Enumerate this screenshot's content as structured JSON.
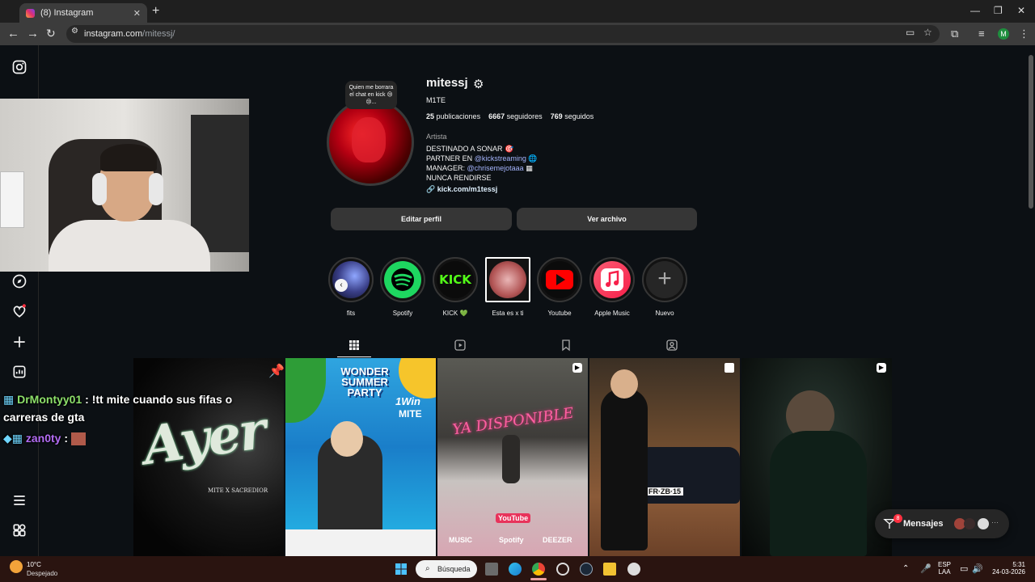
{
  "browser": {
    "tab_title": "(8) Instagram",
    "url_host": "instagram.com",
    "url_path": "/mitessj/",
    "profile_initial": "M"
  },
  "profile": {
    "username": "mitessj",
    "full_name": "M1TE",
    "note": "Quien me borrara el chat en kick 😢😢...",
    "stats": {
      "posts_count": "25",
      "posts_label": "publicaciones",
      "followers_count": "6667",
      "followers_label": "seguidores",
      "following_count": "769",
      "following_label": "seguidos"
    },
    "category": "Artista",
    "bio": {
      "line1": "DESTINADO A SONAR 🎯",
      "line2_prefix": "PARTNER EN ",
      "line2_mention": "@kickstreaming",
      "line2_suffix": " 🌐",
      "line3_prefix": "MANAGER: ",
      "line3_mention": "@chrisemejotaaa",
      "line3_suffix": " ▦",
      "line4": "NUNCA RENDIRSE"
    },
    "link": "kick.com/m1tessj",
    "edit_button": "Editar perfil",
    "archive_button": "Ver archivo"
  },
  "highlights": [
    {
      "label": "fits"
    },
    {
      "label": "Spotify"
    },
    {
      "label": "KICK 💚"
    },
    {
      "label": "Esta es x ti"
    },
    {
      "label": "Youtube"
    },
    {
      "label": "Apple Music"
    },
    {
      "label": "Nuevo"
    }
  ],
  "highlight_art": {
    "kick_text": "KICK"
  },
  "posts": {
    "post1_title": "Ayer",
    "post1_subtitle": "MITE X SACREDIOR",
    "post2_title_a": "WONDER",
    "post2_title_b": "SUMMER",
    "post2_title_c": "PARTY",
    "post2_brand": "1Win",
    "post2_artist": "MITE",
    "post3_text": "YA DISPONIBLE",
    "post3_youtube": "YouTube",
    "post3_music": "MUSIC",
    "post3_spotify": "Spotify",
    "post3_deezer": "DEEZER",
    "post4_plate": "FR·ZB·15"
  },
  "chat": {
    "user1": "DrMontyy01",
    "msg1": ": !tt mite cuando sus fifas o",
    "msg1_cont": "carreras de gta",
    "user2": "zan0ty",
    "msg2": ":"
  },
  "messages": {
    "label": "Mensajes",
    "badge": "8"
  },
  "taskbar": {
    "temperature": "10°C",
    "condition": "Despejado",
    "search_label": "Búsqueda",
    "lang_top": "ESP",
    "lang_bottom": "LAA",
    "time": "5:31",
    "date": "24-03-2026"
  },
  "colors": {
    "page_bg": "#0c1014",
    "accent_mention": "#a5b4fc",
    "notification_red": "#ff3040",
    "kick_green": "#53fc18",
    "spotify_green": "#1ed760"
  }
}
